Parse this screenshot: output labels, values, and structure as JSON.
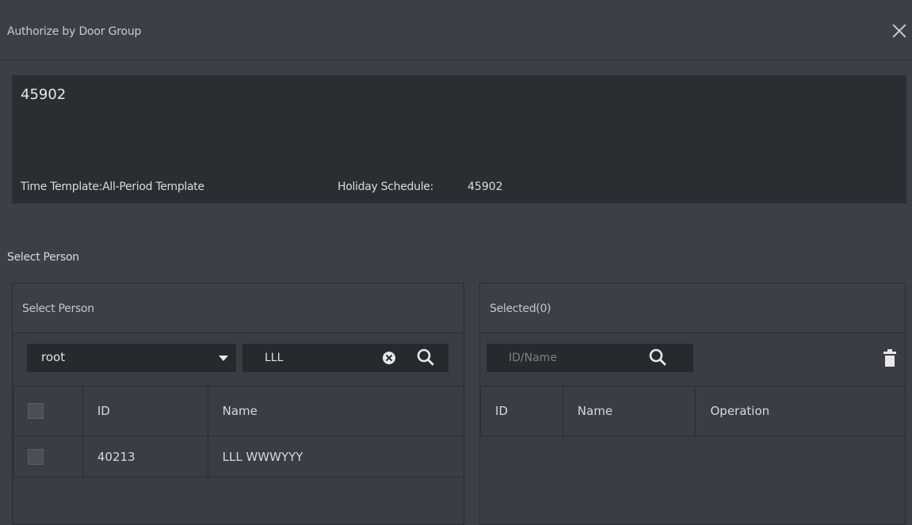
{
  "dialog": {
    "title": "Authorize by Door Group"
  },
  "info": {
    "group_name": "45902",
    "time_template_label": "Time Template:All-Period Template",
    "holiday_schedule_label": "Holiday Schedule:",
    "holiday_schedule_value": "45902"
  },
  "select_person_section_label": "Select Person",
  "left_panel": {
    "header": "Select Person",
    "org_dropdown_value": "root",
    "search_value": "LLL",
    "columns": [
      "",
      "ID",
      "Name"
    ],
    "rows": [
      {
        "id": "40213",
        "name": "LLL WWWYYY"
      }
    ]
  },
  "right_panel": {
    "header": "Selected(0)",
    "search_placeholder": "ID/Name",
    "columns": [
      "ID",
      "Name",
      "Operation"
    ],
    "rows": []
  },
  "colors": {
    "background": "#3c3f45",
    "info_box": "#2a2d31",
    "input_bg": "#26292d",
    "border": "#2b2e33"
  }
}
